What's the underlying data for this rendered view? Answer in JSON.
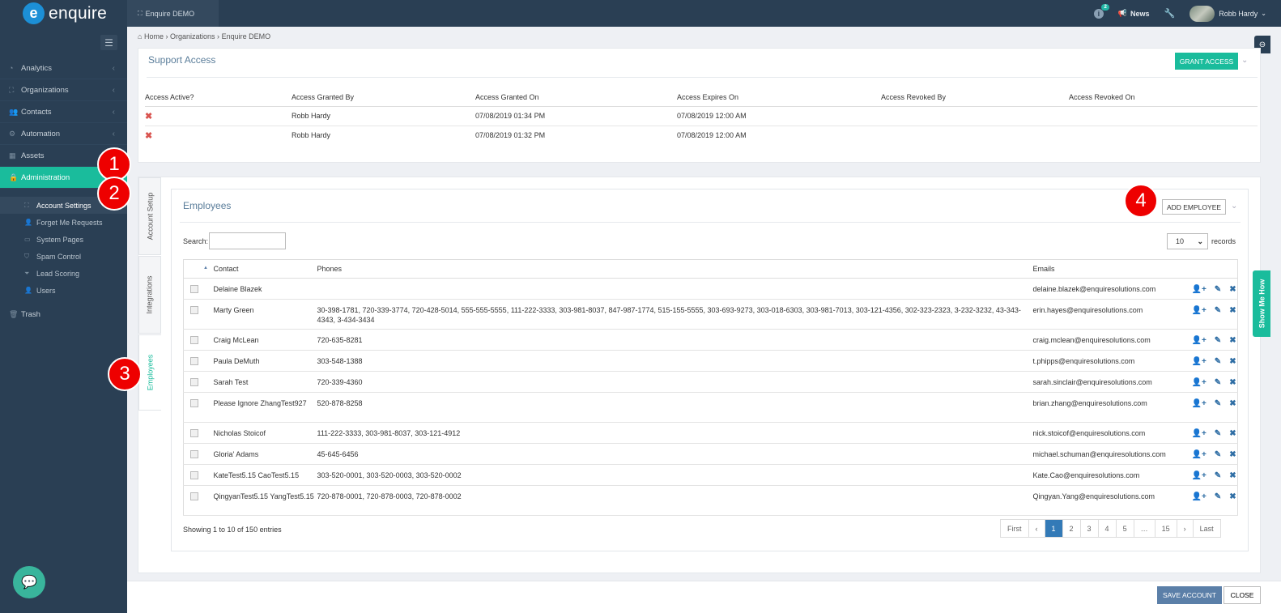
{
  "app": {
    "logo_text": "enquire",
    "logo_letter": "e"
  },
  "topbar": {
    "org_tab": "Enquire DEMO",
    "notification_count": "2",
    "info_glyph": "i",
    "news": "News",
    "user_name": "Robb Hardy"
  },
  "sidebar": {
    "items": [
      {
        "label": "Analytics",
        "icon": "chart-icon"
      },
      {
        "label": "Organizations",
        "icon": "sitemap-icon"
      },
      {
        "label": "Contacts",
        "icon": "users-icon"
      },
      {
        "label": "Automation",
        "icon": "cogs-icon"
      },
      {
        "label": "Assets",
        "icon": "grid-icon"
      },
      {
        "label": "Administration",
        "icon": "lock-icon",
        "active": true
      }
    ],
    "subitems": [
      {
        "label": "Account Settings",
        "active": true
      },
      {
        "label": "Forget Me Requests"
      },
      {
        "label": "System Pages"
      },
      {
        "label": "Spam Control"
      },
      {
        "label": "Lead Scoring"
      },
      {
        "label": "Users"
      }
    ],
    "trash": "Trash"
  },
  "breadcrumb": {
    "home": "Home",
    "sep": "›",
    "organizations": "Organizations",
    "current": "Enquire DEMO"
  },
  "support_access": {
    "title": "Support Access",
    "grant_button": "GRANT ACCESS",
    "columns": [
      "Access Active?",
      "Access Granted By",
      "Access Granted On",
      "Access Expires On",
      "Access Revoked By",
      "Access Revoked On"
    ],
    "rows": [
      {
        "active": "✖",
        "granted_by": "Robb Hardy",
        "granted_on": "07/08/2019 01:34 PM",
        "expires_on": "07/08/2019 12:00 AM",
        "revoked_by": "",
        "revoked_on": ""
      },
      {
        "active": "✖",
        "granted_by": "Robb Hardy",
        "granted_on": "07/08/2019 01:32 PM",
        "expires_on": "07/08/2019 12:00 AM",
        "revoked_by": "",
        "revoked_on": ""
      }
    ]
  },
  "tabs": {
    "account_setup": "Account Setup",
    "integrations": "Integrations",
    "employees": "Employees"
  },
  "employees": {
    "title": "Employees",
    "add_button": "ADD EMPLOYEE",
    "search_label": "Search:",
    "page_length": "10",
    "records_label": "records",
    "columns": {
      "contact": "Contact",
      "phones": "Phones",
      "emails": "Emails"
    },
    "rows": [
      {
        "contact": "Delaine Blazek",
        "phones": "",
        "email": "delaine.blazek@enquiresolutions.com"
      },
      {
        "contact": "Marty Green",
        "phones": "30-398-1781, 720-339-3774, 720-428-5014, 555-555-5555, 111-222-3333, 303-981-8037, 847-987-1774, 515-155-5555, 303-693-9273, 303-018-6303, 303-981-7013, 303-121-4356, 302-323-2323, 3-232-3232, 43-343-4343, 3-434-3434",
        "email": "erin.hayes@enquiresolutions.com"
      },
      {
        "contact": "Craig McLean",
        "phones": "720-635-8281",
        "email": "craig.mclean@enquiresolutions.com"
      },
      {
        "contact": "Paula DeMuth",
        "phones": "303-548-1388",
        "email": "t.phipps@enquiresolutions.com"
      },
      {
        "contact": "Sarah Test",
        "phones": "720-339-4360",
        "email": "sarah.sinclair@enquiresolutions.com"
      },
      {
        "contact": "Please Ignore ZhangTest927",
        "phones": "520-878-8258",
        "email": "brian.zhang@enquiresolutions.com"
      },
      {
        "contact": "Nicholas Stoicof",
        "phones": "111-222-3333, 303-981-8037, 303-121-4912",
        "email": "nick.stoicof@enquiresolutions.com"
      },
      {
        "contact": "Gloria' Adams",
        "phones": "45-645-6456",
        "email": "michael.schuman@enquiresolutions.com"
      },
      {
        "contact": "KateTest5.15 CaoTest5.15",
        "phones": "303-520-0001, 303-520-0003, 303-520-0002",
        "email": "Kate.Cao@enquiresolutions.com"
      },
      {
        "contact": "QingyanTest5.15 YangTest5.15",
        "phones": "720-878-0001, 720-878-0003, 720-878-0002",
        "email": "Qingyan.Yang@enquiresolutions.com"
      }
    ],
    "showing": "Showing 1 to 10 of 150 entries",
    "pager": [
      "First",
      "‹",
      "1",
      "2",
      "3",
      "4",
      "5",
      "…",
      "15",
      "›",
      "Last"
    ],
    "current_page": "1"
  },
  "annotations": [
    "1",
    "2",
    "3",
    "4"
  ],
  "footer": {
    "save": "SAVE ACCOUNT",
    "close": "CLOSE"
  },
  "show_me_how": "Show Me How",
  "colors": {
    "sidebar": "#2a3f54",
    "accent": "#1abc9c",
    "primary": "#337ab7",
    "annotation": "#ee0000"
  }
}
